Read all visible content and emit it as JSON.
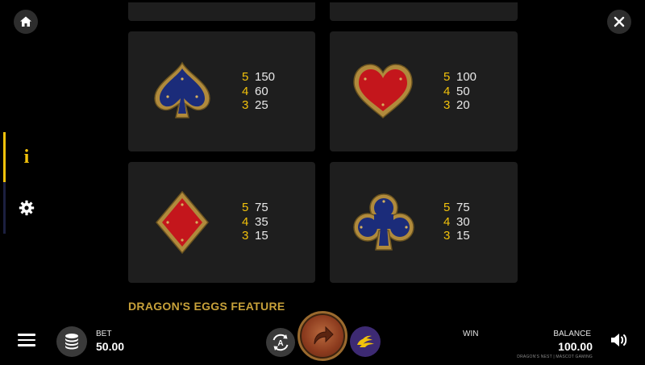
{
  "nav": {
    "home_icon": "home-icon",
    "close_icon": "close-icon",
    "info_label": "i",
    "settings_icon": "gear-icon",
    "accent_color": "#f2c20b"
  },
  "paytable": [
    {
      "symbol": "spade",
      "color": "#1b2c7a",
      "rows": [
        {
          "count": "5",
          "value": "150"
        },
        {
          "count": "4",
          "value": "60"
        },
        {
          "count": "3",
          "value": "25"
        }
      ]
    },
    {
      "symbol": "heart",
      "color": "#c4161c",
      "rows": [
        {
          "count": "5",
          "value": "100"
        },
        {
          "count": "4",
          "value": "50"
        },
        {
          "count": "3",
          "value": "20"
        }
      ]
    },
    {
      "symbol": "diamond",
      "color": "#c4161c",
      "rows": [
        {
          "count": "5",
          "value": "75"
        },
        {
          "count": "4",
          "value": "35"
        },
        {
          "count": "3",
          "value": "15"
        }
      ]
    },
    {
      "symbol": "club",
      "color": "#1b2c7a",
      "rows": [
        {
          "count": "5",
          "value": "75"
        },
        {
          "count": "4",
          "value": "30"
        },
        {
          "count": "3",
          "value": "15"
        }
      ]
    }
  ],
  "feature_title": "DRAGON'S EGGS FEATURE",
  "bottom_bar": {
    "bet_label": "BET",
    "bet_value": "50.00",
    "win_label": "WIN",
    "balance_label": "BALANCE",
    "balance_value": "100.00",
    "footer_credit": "DRAGON'S NEST | MASCOT GAMING"
  }
}
